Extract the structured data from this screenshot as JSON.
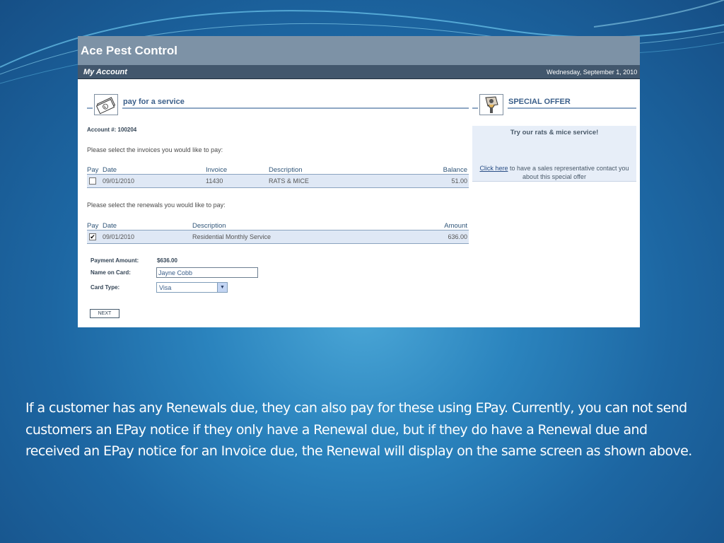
{
  "app": {
    "title": "Ace Pest Control",
    "nav_item": "My Account",
    "date": "Wednesday, September 1, 2010"
  },
  "pay_section": {
    "title": "pay for a service",
    "icon": "money-bill-icon",
    "account_label": "Account #: 100204",
    "invoices_prompt": "Please select the invoices you would like to pay:",
    "invoice_table": {
      "headers": [
        "Pay",
        "Date",
        "Invoice",
        "Description",
        "Balance"
      ],
      "rows": [
        {
          "checked": false,
          "check_glyph": "",
          "date": "09/01/2010",
          "invoice": "11430",
          "description": "RATS & MICE",
          "balance": "51.00"
        }
      ]
    },
    "renewals_prompt": "Please select the renewals you would like to pay:",
    "renewal_table": {
      "headers": [
        "Pay",
        "Date",
        "Description",
        "Amount"
      ],
      "rows": [
        {
          "checked": true,
          "check_glyph": "✔",
          "date": "09/01/2010",
          "description": "Residential Monthly Service",
          "amount": "636.00"
        }
      ]
    },
    "form": {
      "payment_amount_label": "Payment Amount:",
      "payment_amount_value": "$636.00",
      "name_label": "Name on Card:",
      "name_value": "Jayne Cobb",
      "card_type_label": "Card Type:",
      "card_type_value": "Visa",
      "next_label": "NEXT"
    }
  },
  "offer_section": {
    "title": "SPECIAL OFFER",
    "icon": "pest-control-tag-icon",
    "headline": "Try our rats & mice service!",
    "link_text": "Click here",
    "contact_text": " to have a sales representative contact you about this special offer"
  },
  "caption": "If a customer has any Renewals due, they can also pay for these using EPay.  Currently, you can not send customers an EPay notice if they only have a Renewal due, but if they do have a Renewal due and received an EPay notice for an Invoice due, the Renewal will display on the same screen as shown above."
}
